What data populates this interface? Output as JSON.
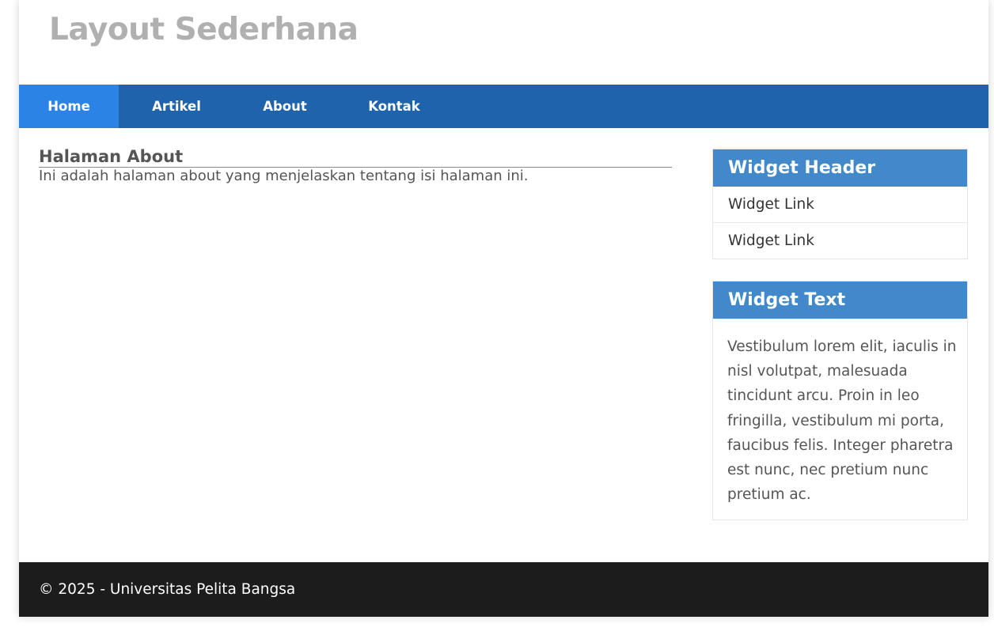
{
  "header": {
    "title": "Layout Sederhana"
  },
  "nav": {
    "items": [
      {
        "label": "Home",
        "active": true
      },
      {
        "label": "Artikel",
        "active": false
      },
      {
        "label": "About",
        "active": false
      },
      {
        "label": "Kontak",
        "active": false
      }
    ]
  },
  "main": {
    "title": "Halaman About",
    "text": "Ini adalah halaman about yang menjelaskan tentang isi halaman ini."
  },
  "sidebar": {
    "widgets": [
      {
        "header": "Widget Header",
        "links": [
          "Widget Link",
          "Widget Link"
        ]
      },
      {
        "header": "Widget Text",
        "body": "Vestibulum lorem elit, iaculis in nisl volutpat, malesuada tincidunt arcu. Proin in leo fringilla, vestibulum mi porta, faucibus felis. Integer pharetra est nunc, nec pretium nunc pretium ac."
      }
    ]
  },
  "footer": {
    "text": "© 2025 - Universitas Pelita Bangsa"
  },
  "colors": {
    "nav_background": "#2063ad",
    "nav_active": "#2b83e6",
    "widget_header": "#4189cb",
    "footer_background": "#1c1c1c",
    "title_gray": "#b0b0b0"
  }
}
